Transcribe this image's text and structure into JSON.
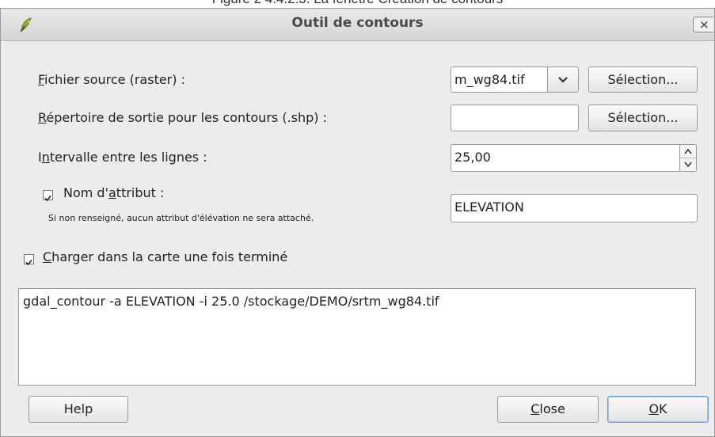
{
  "page_caption": "Figure 2 4.4.2.3. La fenêtre Création de contours",
  "dialog": {
    "title": "Outil de contours",
    "close_glyph": "×"
  },
  "source_label": {
    "pre": "",
    "key": "F",
    "post": "ichier source (raster) :"
  },
  "source_value": "m_wg84.tif",
  "output_label": {
    "pre": "",
    "key": "R",
    "post": "épertoire de sortie pour les contours (.shp) :"
  },
  "output_value": "",
  "select_button_label": "Sélection...",
  "interval_label": {
    "pre": "I",
    "key": "n",
    "post": "tervalle entre les lignes :"
  },
  "interval_value": "25,00",
  "attribute_checkbox": {
    "checked": true,
    "label": {
      "pre": "Nom d'",
      "key": "a",
      "post": "ttribut :"
    },
    "hint": "Si non renseigné, aucun attribut d'élévation ne sera attaché."
  },
  "attribute_value": "ELEVATION",
  "load_checkbox": {
    "checked": true,
    "label": {
      "pre": "",
      "key": "C",
      "post": "harger dans la carte une fois terminé"
    }
  },
  "command_text": "gdal_contour -a ELEVATION -i 25.0 /stockage/DEMO/srtm_wg84.tif",
  "buttons": {
    "help": "Help",
    "close": {
      "pre": "",
      "key": "C",
      "post": "lose"
    },
    "ok": {
      "pre": "",
      "key": "O",
      "post": "K"
    }
  }
}
